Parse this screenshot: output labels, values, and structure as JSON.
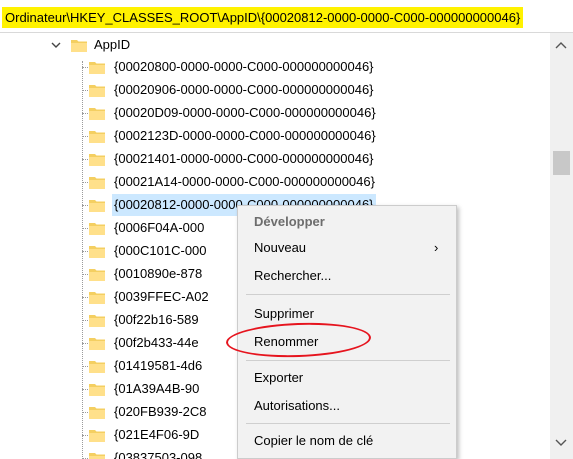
{
  "address_bar": {
    "path": "Ordinateur\\HKEY_CLASSES_ROOT\\AppID\\{00020812-0000-0000-C000-000000000046}",
    "highlight_color": "#fff200"
  },
  "tree": {
    "parent_label": "AppID",
    "rows": [
      "{00020800-0000-0000-C000-000000000046}",
      "{00020906-0000-0000-C000-000000000046}",
      "{00020D09-0000-0000-C000-000000000046}",
      "{0002123D-0000-0000-C000-000000000046}",
      "{00021401-0000-0000-C000-000000000046}",
      "{00021A14-0000-0000-C000-000000000046}",
      "{00020812-0000-0000-C000-000000000046}",
      "{0006F04A-000",
      "{000C101C-000",
      "{0010890e-878",
      "{0039FFEC-A02",
      "{00f22b16-589",
      "{00f2b433-44e",
      "{01419581-4d6",
      "{01A39A4B-90",
      "{020FB939-2C8",
      "{021E4F06-9D",
      "{03837503-098"
    ],
    "selected_index": 6,
    "selected_color": "#cce8ff"
  },
  "context_menu": {
    "items": {
      "developper": "Développer",
      "nouveau": "Nouveau",
      "rechercher": "Rechercher...",
      "supprimer": "Supprimer",
      "renommer": "Renommer",
      "exporter": "Exporter",
      "autorisations": "Autorisations...",
      "copier": "Copier le nom de clé"
    },
    "submenu_arrow": "›",
    "highlight_oval_color": "#e6141e"
  },
  "scrollbar": {
    "up_arrow": "^",
    "down_arrow": "v"
  },
  "icons": {
    "folder": "folder-icon",
    "chevron": "chevron-down-icon"
  }
}
